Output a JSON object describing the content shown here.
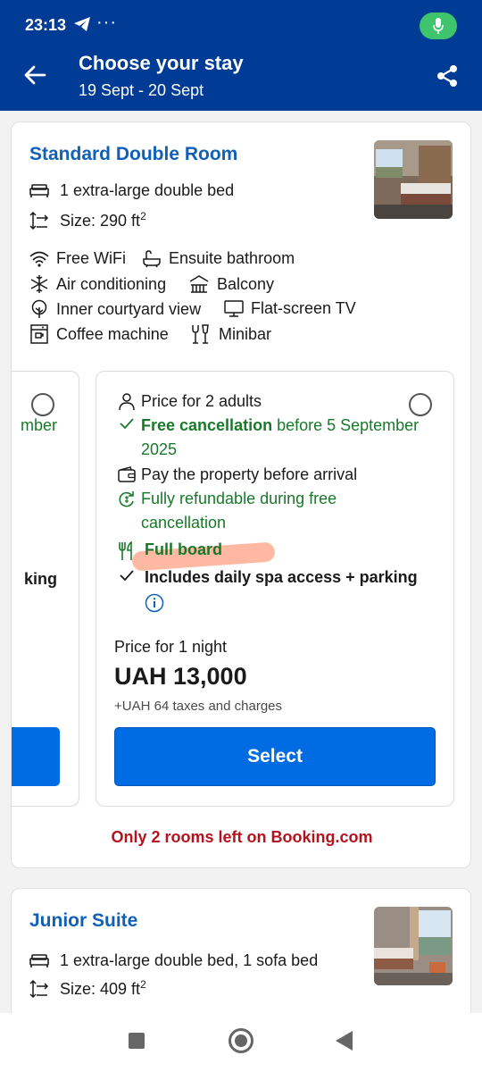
{
  "status_bar": {
    "time": "23:13",
    "dots": "···"
  },
  "header": {
    "title": "Choose your stay",
    "dates": "19 Sept - 20 Sept"
  },
  "rooms": [
    {
      "name": "Standard Double Room",
      "bed": "1 extra-large double bed",
      "size_prefix": "Size: 290 ft",
      "size_sup": "2",
      "facilities": [
        {
          "label": "Free WiFi",
          "icon": "wifi-icon"
        },
        {
          "label": "Ensuite bathroom",
          "icon": "bath-icon"
        },
        {
          "label": "Air conditioning",
          "icon": "snowflake-icon"
        },
        {
          "label": "Balcony",
          "icon": "balcony-icon"
        },
        {
          "label": "Inner courtyard view",
          "icon": "tree-icon"
        },
        {
          "label": "Flat-screen TV",
          "icon": "tv-icon"
        },
        {
          "label": "Coffee machine",
          "icon": "coffee-machine-icon"
        },
        {
          "label": "Minibar",
          "icon": "minibar-icon"
        }
      ],
      "left_option_fragments": {
        "mber": "mber",
        "king": "king"
      },
      "option": {
        "guests": "Price for 2 adults",
        "free_cancel_bold": "Free cancellation",
        "free_cancel_rest_1": " before 5 September",
        "free_cancel_rest_2": "2025",
        "pay": "Pay the property before arrival",
        "refund_1": "Fully refundable during free",
        "refund_2": "cancellation",
        "meal": "Full board",
        "includes": "Includes daily spa access + parking",
        "price_label": "Price for 1 night",
        "price": "UAH 13,000",
        "taxes": "+UAH 64 taxes and charges",
        "select_label": "Select"
      },
      "scarcity": "Only 2 rooms left on Booking.com"
    },
    {
      "name": "Junior Suite",
      "bed": "1 extra-large double bed, 1 sofa bed",
      "size_prefix": "Size: 409 ft",
      "size_sup": "2"
    }
  ],
  "colors": {
    "header": "#003b95",
    "link": "#1160b8",
    "green": "#19792a",
    "button": "#006ce4",
    "scarcity": "#b3121f"
  }
}
